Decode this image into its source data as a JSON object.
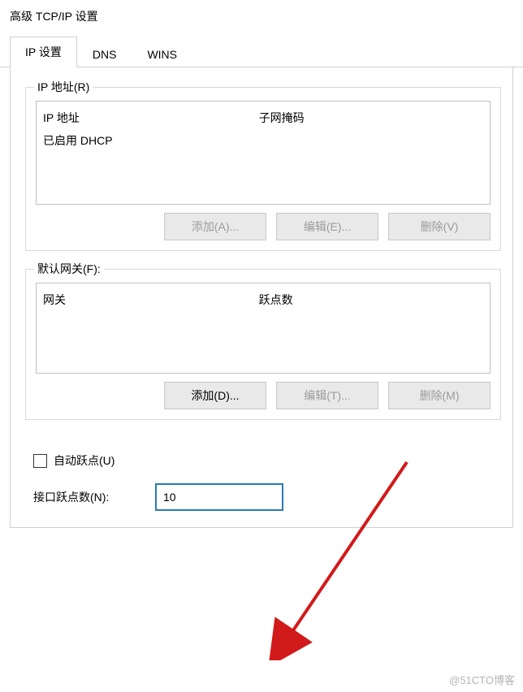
{
  "window_title": "高级 TCP/IP 设置",
  "tabs": {
    "ip": "IP 设置",
    "dns": "DNS",
    "wins": "WINS"
  },
  "ip_group": {
    "legend": "IP 地址(R)",
    "col_ip": "IP 地址",
    "col_mask": "子网掩码",
    "dhcp_row": "已启用 DHCP",
    "add": "添加(A)...",
    "edit": "编辑(E)...",
    "remove": "删除(V)"
  },
  "gw_group": {
    "legend": "默认网关(F):",
    "col_gw": "网关",
    "col_metric": "跃点数",
    "add": "添加(D)...",
    "edit": "编辑(T)...",
    "remove": "删除(M)"
  },
  "auto_metric_label": "自动跃点(U)",
  "iface_metric_label": "接口跃点数(N):",
  "iface_metric_value": "10",
  "watermark": "@51CTO博客"
}
